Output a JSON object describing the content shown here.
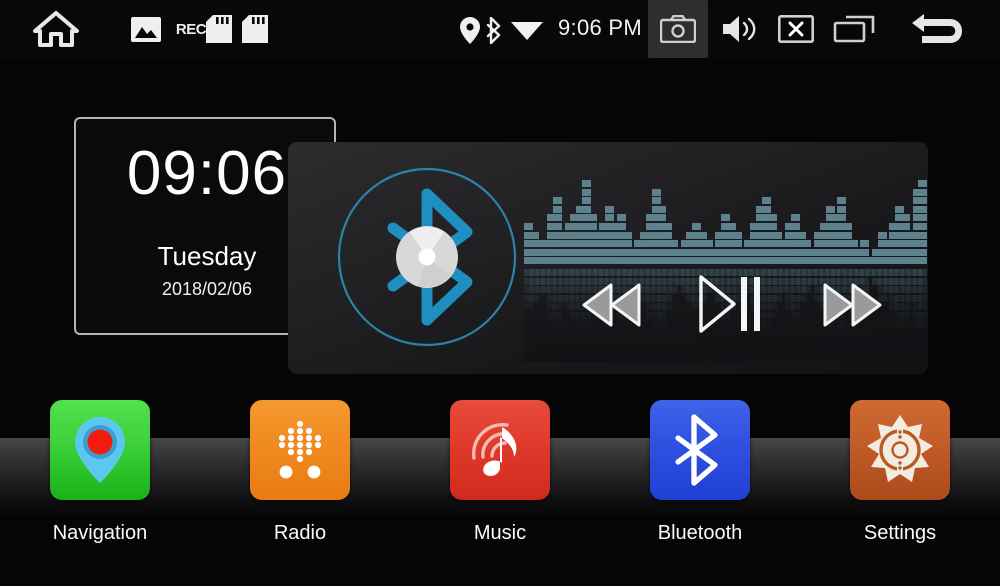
{
  "statusbar": {
    "left_icons": [
      {
        "name": "home-icon",
        "label": "Home"
      },
      {
        "name": "gallery-icon",
        "label": "Gallery"
      },
      {
        "name": "rec-icon",
        "label": "REC"
      },
      {
        "name": "sdcard-icon-1",
        "label": "SD Card 1"
      },
      {
        "name": "sdcard-icon-2",
        "label": "SD Card 2"
      }
    ],
    "rec_label": "REC",
    "time": "9:06 PM",
    "right_icons": [
      {
        "name": "gps-location-icon",
        "label": "GPS"
      },
      {
        "name": "bluetooth-icon",
        "label": "Bluetooth"
      },
      {
        "name": "wifi-icon",
        "label": "Wi-Fi"
      },
      {
        "name": "camera-icon",
        "label": "Camera"
      },
      {
        "name": "volume-icon",
        "label": "Volume"
      },
      {
        "name": "close-icon",
        "label": "Close"
      },
      {
        "name": "recent-apps-icon",
        "label": "Recent Apps"
      },
      {
        "name": "back-icon",
        "label": "Back"
      }
    ]
  },
  "clock_widget": {
    "time": "09:06",
    "weekday": "Tuesday",
    "date": "2018/02/06"
  },
  "music_widget": {
    "source_icon": "bluetooth-disc-icon",
    "controls": {
      "previous": "Previous",
      "play_pause": "Play/Pause",
      "next": "Next"
    },
    "equalizer": {
      "levels": [
        5,
        4,
        3,
        3,
        6,
        8,
        4,
        5,
        6,
        7,
        10,
        6,
        4,
        5,
        7,
        5,
        6,
        4,
        2,
        3,
        4,
        6,
        9,
        7,
        5,
        3,
        2,
        3,
        4,
        5,
        4,
        3,
        2,
        4,
        6,
        5,
        4,
        2,
        3,
        5,
        7,
        8,
        6,
        4,
        3,
        5,
        6,
        4,
        3,
        2,
        4,
        5,
        7,
        6,
        8,
        5,
        3,
        2,
        3,
        1,
        2,
        4,
        3,
        5,
        7,
        6,
        4,
        9,
        10
      ],
      "bar_color": "#5d828e",
      "reflection_color": "#3d5a64"
    }
  },
  "dock": {
    "apps": [
      {
        "label": "Navigation",
        "icon": "map-pin-icon",
        "color": "#3fd23c"
      },
      {
        "label": "Radio",
        "icon": "radio-dots-icon",
        "color": "#ef8a21"
      },
      {
        "label": "Music",
        "icon": "music-note-icon",
        "color": "#e03a2b"
      },
      {
        "label": "Bluetooth",
        "icon": "bluetooth-icon",
        "color": "#2f50df"
      },
      {
        "label": "Settings",
        "icon": "gear-star-icon",
        "color": "#c25c28"
      }
    ]
  },
  "theme": {
    "background": "#050506",
    "accent_cyan": "#1f8fbd",
    "text": "#fafafa"
  }
}
